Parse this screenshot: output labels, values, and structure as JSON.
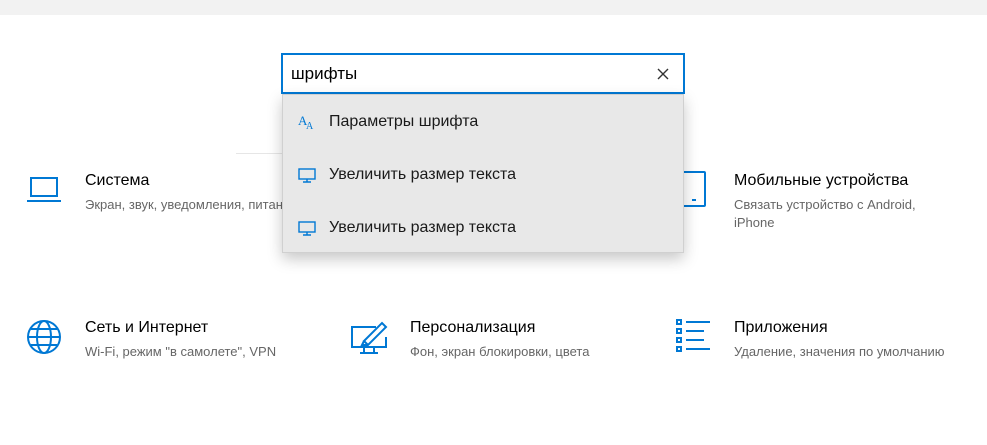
{
  "search": {
    "value": "шрифты",
    "placeholder": ""
  },
  "suggestions": [
    {
      "label": "Параметры шрифта",
      "icon": "font-icon"
    },
    {
      "label": "Увеличить размер текста",
      "icon": "monitor-icon"
    },
    {
      "label": "Увеличить размер текста",
      "icon": "monitor-icon"
    }
  ],
  "tiles": [
    {
      "title": "Система",
      "desc": "Экран, звук, уведомления, питание",
      "icon": "laptop-icon"
    },
    {
      "title": "Мобильные устройства",
      "desc": "Связать устройство с Android, iPhone",
      "icon": "phone-icon"
    },
    {
      "title": "Сеть и Интернет",
      "desc": "Wi-Fi, режим \"в самолете\", VPN",
      "icon": "globe-icon"
    },
    {
      "title": "Персонализация",
      "desc": "Фон, экран блокировки, цвета",
      "icon": "personalization-icon"
    },
    {
      "title": "Приложения",
      "desc": "Удаление, значения по умолчанию",
      "icon": "apps-list-icon"
    }
  ],
  "colors": {
    "accent": "#0078d4",
    "dropdown_bg": "#e8e8e8",
    "desc_text": "#666666"
  }
}
